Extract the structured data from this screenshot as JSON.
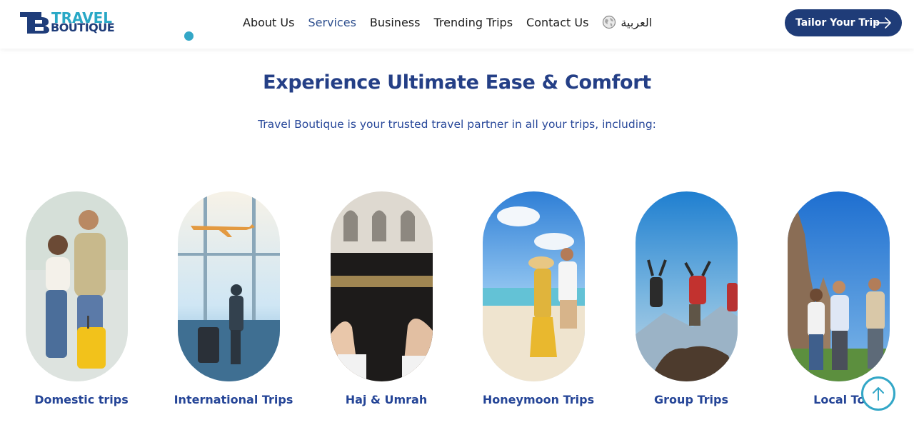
{
  "brand": {
    "line1": "TRAVEL",
    "line2": "BOUTIQUE",
    "colors": {
      "navy": "#1f3c78",
      "teal": "#33a7c7"
    }
  },
  "nav": {
    "items": [
      {
        "label": "About Us",
        "active": false
      },
      {
        "label": "Services",
        "active": true
      },
      {
        "label": "Business",
        "active": false
      },
      {
        "label": "Trending Trips",
        "active": false
      },
      {
        "label": "Contact Us",
        "active": false
      }
    ],
    "language": {
      "label": "العربية",
      "icon": "globe-icon"
    }
  },
  "cta": {
    "label": "Tailor Your Trip",
    "icon": "arrow-right-icon"
  },
  "hero": {
    "title": "Experience Ultimate Ease & Comfort",
    "subtitle": "Travel Boutique is your trusted travel partner in all your trips, including:"
  },
  "trips": [
    {
      "label": "Domestic trips"
    },
    {
      "label": "International Trips"
    },
    {
      "label": "Haj & Umrah"
    },
    {
      "label": "Honeymoon Trips"
    },
    {
      "label": "Group Trips"
    },
    {
      "label": "Local Tou"
    }
  ],
  "scroll_top": {
    "icon": "arrow-up-icon"
  }
}
